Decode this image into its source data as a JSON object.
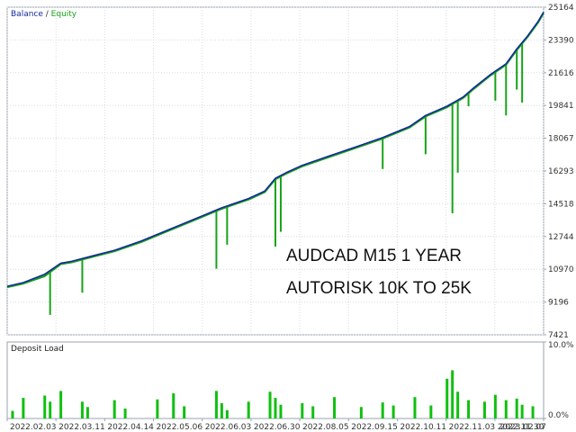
{
  "colors": {
    "balance": "#1428a0",
    "equity": "#17a317",
    "load": "#10c010",
    "frame": "#9aa3b0",
    "grid": "#d6dbe2"
  },
  "chart_data": [
    {
      "type": "line",
      "legend": {
        "balance": "Balance",
        "separator": " / ",
        "equity": "Equity",
        "placement": "top-left"
      },
      "y_ticks": [
        "25164",
        "23390",
        "21616",
        "19841",
        "18067",
        "16293",
        "14518",
        "12744",
        "10970",
        "9196",
        "7421"
      ],
      "ylim": [
        7421,
        25164
      ],
      "grid": true,
      "annotation_lines": [
        "AUDCAD M15 1 YEAR",
        "AUTORISK 10K TO 25K"
      ],
      "series": [
        {
          "name": "Balance",
          "x": [
            0,
            0.03,
            0.07,
            0.1,
            0.12,
            0.16,
            0.2,
            0.25,
            0.3,
            0.35,
            0.4,
            0.45,
            0.48,
            0.5,
            0.52,
            0.55,
            0.6,
            0.65,
            0.7,
            0.75,
            0.78,
            0.82,
            0.85,
            0.87,
            0.9,
            0.93,
            0.95,
            0.97,
            0.99,
            1.0
          ],
          "values": [
            10050,
            10250,
            10700,
            11300,
            11400,
            11700,
            12000,
            12500,
            13100,
            13700,
            14300,
            14800,
            15200,
            15900,
            16200,
            16600,
            17100,
            17600,
            18100,
            18700,
            19300,
            19800,
            20300,
            20800,
            21500,
            22100,
            22900,
            23600,
            24400,
            24900
          ]
        },
        {
          "name": "Equity",
          "x": [
            0,
            0.03,
            0.07,
            0.1,
            0.12,
            0.16,
            0.2,
            0.25,
            0.3,
            0.35,
            0.4,
            0.45,
            0.48,
            0.5,
            0.52,
            0.55,
            0.6,
            0.65,
            0.7,
            0.75,
            0.78,
            0.82,
            0.85,
            0.87,
            0.9,
            0.93,
            0.95,
            0.97,
            0.99,
            1.0
          ],
          "values": [
            10000,
            10200,
            10600,
            11250,
            11350,
            11650,
            11950,
            12450,
            13050,
            13650,
            14250,
            14750,
            15150,
            15850,
            16150,
            16550,
            17050,
            17550,
            18050,
            18650,
            19250,
            19750,
            20250,
            20750,
            21450,
            22050,
            22850,
            23550,
            24350,
            24850
          ]
        }
      ],
      "equity_dips": [
        {
          "x": 0.08,
          "value": 8500
        },
        {
          "x": 0.14,
          "value": 9700
        },
        {
          "x": 0.39,
          "value": 11000
        },
        {
          "x": 0.41,
          "value": 12300
        },
        {
          "x": 0.5,
          "value": 12200
        },
        {
          "x": 0.51,
          "value": 13000
        },
        {
          "x": 0.7,
          "value": 16400
        },
        {
          "x": 0.78,
          "value": 17200
        },
        {
          "x": 0.83,
          "value": 14000
        },
        {
          "x": 0.84,
          "value": 16200
        },
        {
          "x": 0.86,
          "value": 19800
        },
        {
          "x": 0.91,
          "value": 20100
        },
        {
          "x": 0.93,
          "value": 19300
        },
        {
          "x": 0.95,
          "value": 20700
        },
        {
          "x": 0.96,
          "value": 20000
        }
      ]
    },
    {
      "type": "bar",
      "legend": {
        "label": "Deposit Load"
      },
      "y_ticks": [
        "10.0%",
        "0.0%"
      ],
      "ylim": [
        0,
        10
      ],
      "x_ticks": [
        "2022.02.03",
        "2022.03.11",
        "2022.04.14",
        "2022.05.06",
        "2022.06.03",
        "2022.06.30",
        "2022.08.05",
        "2022.09.15",
        "2022.10.11",
        "2022.11.03",
        "2022.11.30",
        "2023.02.07"
      ],
      "x": [
        0.01,
        0.03,
        0.07,
        0.08,
        0.1,
        0.14,
        0.15,
        0.2,
        0.22,
        0.28,
        0.31,
        0.33,
        0.39,
        0.4,
        0.41,
        0.45,
        0.49,
        0.5,
        0.51,
        0.55,
        0.57,
        0.61,
        0.66,
        0.7,
        0.72,
        0.76,
        0.79,
        0.82,
        0.83,
        0.84,
        0.86,
        0.89,
        0.91,
        0.93,
        0.95,
        0.96,
        0.98
      ],
      "values": [
        1.0,
        2.7,
        3.0,
        2.2,
        3.6,
        2.2,
        1.5,
        2.4,
        1.3,
        2.5,
        3.3,
        1.6,
        3.6,
        2.0,
        1.1,
        2.2,
        3.5,
        2.7,
        1.8,
        2.0,
        1.6,
        2.8,
        1.5,
        2.1,
        1.7,
        2.8,
        1.7,
        5.2,
        6.3,
        3.5,
        2.4,
        2.2,
        3.1,
        2.4,
        2.6,
        1.8,
        1.6
      ]
    }
  ]
}
